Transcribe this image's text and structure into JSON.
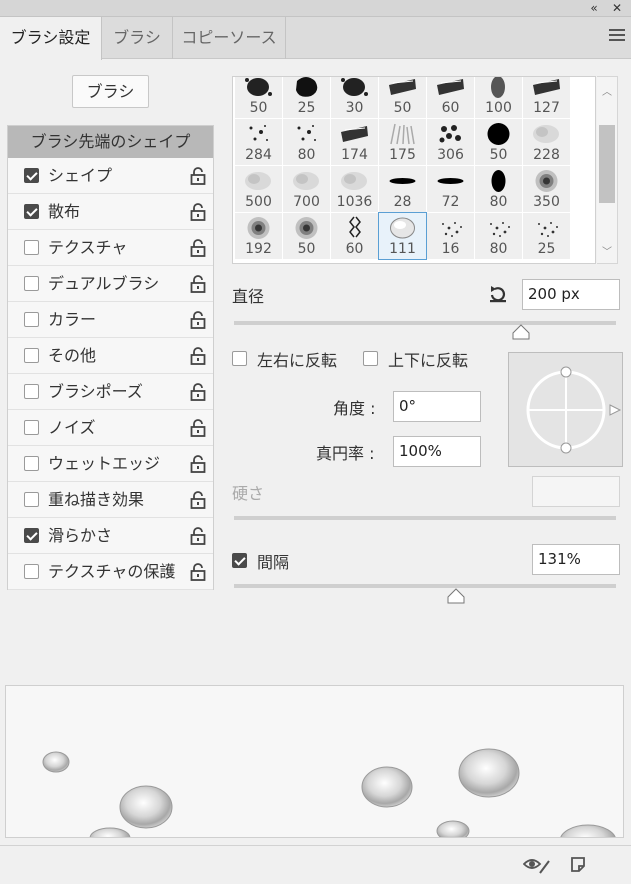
{
  "window": {
    "collapse_glyph": "«",
    "close_glyph": "✕"
  },
  "tabs": [
    {
      "label": "ブラシ設定",
      "active": true
    },
    {
      "label": "ブラシ",
      "active": false
    },
    {
      "label": "コピーソース",
      "active": false
    }
  ],
  "brush_button_label": "ブラシ",
  "options_list": {
    "header": "ブラシ先端のシェイプ",
    "items": [
      {
        "label": "シェイプ",
        "checked": true
      },
      {
        "label": "散布",
        "checked": true
      },
      {
        "label": "テクスチャ",
        "checked": false
      },
      {
        "label": "デュアルブラシ",
        "checked": false
      },
      {
        "label": "カラー",
        "checked": false
      },
      {
        "label": "その他",
        "checked": false
      },
      {
        "label": "ブラシポーズ",
        "checked": false
      },
      {
        "label": "ノイズ",
        "checked": false
      },
      {
        "label": "ウェットエッジ",
        "checked": false
      },
      {
        "label": "重ね描き効果",
        "checked": false
      },
      {
        "label": "滑らかさ",
        "checked": true
      },
      {
        "label": "テクスチャの保護",
        "checked": false
      }
    ]
  },
  "brush_presets": [
    [
      "50",
      "25",
      "30",
      "50",
      "60",
      "100",
      "127"
    ],
    [
      "284",
      "80",
      "174",
      "175",
      "306",
      "50",
      "228"
    ],
    [
      "500",
      "700",
      "1036",
      "28",
      "72",
      "80",
      "350"
    ],
    [
      "192",
      "50",
      "60",
      "111",
      "16",
      "80",
      "25"
    ]
  ],
  "selected_preset": {
    "row": 3,
    "col": 3
  },
  "diameter": {
    "label": "直径",
    "value": "200 px",
    "slider_fraction": 0.75
  },
  "flip": {
    "x_label": "左右に反転",
    "y_label": "上下に反転",
    "x_checked": false,
    "y_checked": false
  },
  "angle": {
    "label": "角度 :",
    "value": "0°"
  },
  "roundness": {
    "label": "真円率 :",
    "value": "100%"
  },
  "hardness": {
    "label": "硬さ",
    "value": ""
  },
  "spacing": {
    "label": "間隔",
    "checked": true,
    "value": "131%",
    "slider_fraction": 0.58
  }
}
